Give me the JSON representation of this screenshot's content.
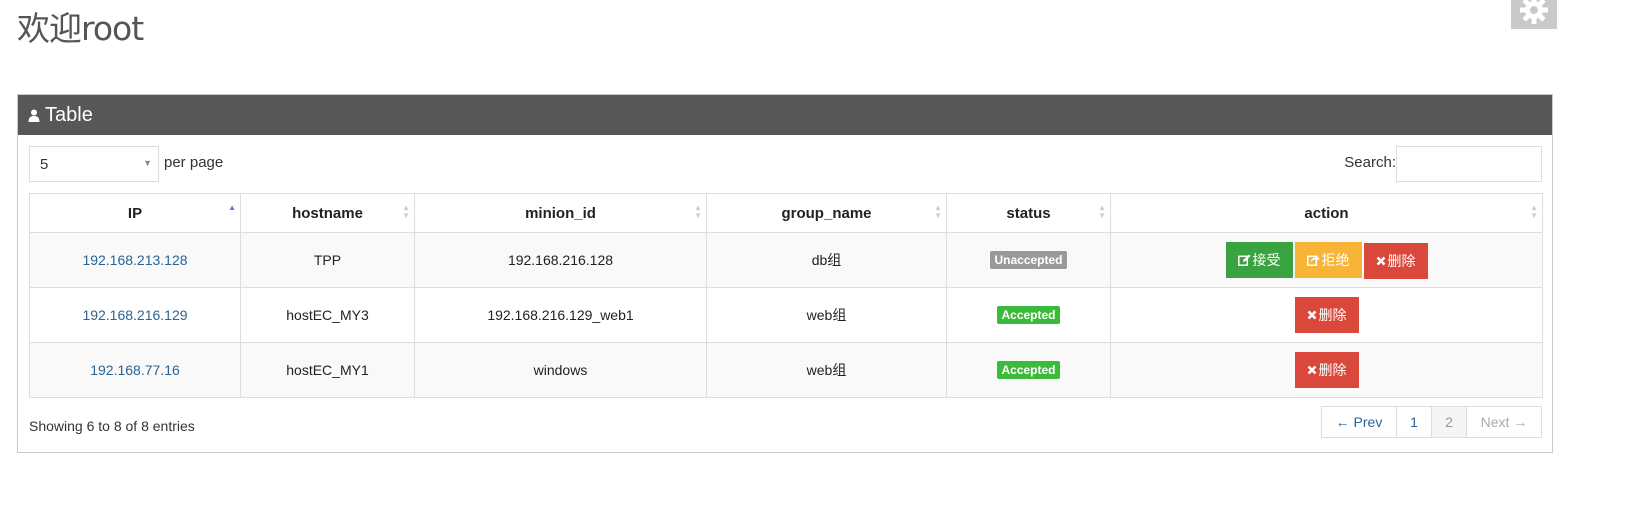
{
  "welcome": "欢迎root",
  "panel": {
    "title": "Table"
  },
  "length": {
    "value": "5",
    "suffix": "per page"
  },
  "search": {
    "label": "Search:",
    "value": ""
  },
  "columns": [
    "IP",
    "hostname",
    "minion_id",
    "group_name",
    "status",
    "action"
  ],
  "rows": [
    {
      "ip": "192.168.213.128",
      "hostname": "TPP",
      "minion_id": "192.168.216.128",
      "group": "db组",
      "status": "Unaccepted",
      "actions": [
        "接受",
        "拒绝",
        "删除"
      ]
    },
    {
      "ip": "192.168.216.129",
      "hostname": "hostEC_MY3",
      "minion_id": "192.168.216.129_web1",
      "group": "web组",
      "status": "Accepted",
      "actions": [
        "删除"
      ]
    },
    {
      "ip": "192.168.77.16",
      "hostname": "hostEC_MY1",
      "minion_id": "windows",
      "group": "web组",
      "status": "Accepted",
      "actions": [
        "删除"
      ]
    }
  ],
  "info": "Showing 6 to 8 of 8 entries",
  "pagination": {
    "prev": "← Prev",
    "pages": [
      "1",
      "2"
    ],
    "next": "Next →"
  },
  "colors": {
    "header_bg": "#575757",
    "accept": "#3aa341",
    "reject": "#f7b437",
    "delete": "#d9483b",
    "link": "#2a6496"
  }
}
